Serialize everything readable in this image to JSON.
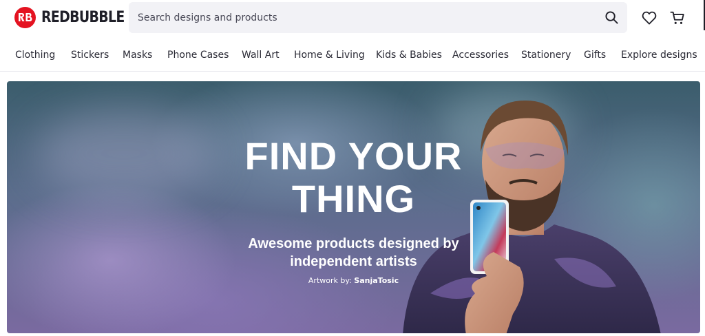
{
  "header": {
    "logo_text": "REDBUBBLE",
    "search_placeholder": "Search designs and products",
    "icons": [
      "search-icon",
      "heart-icon",
      "cart-icon"
    ]
  },
  "nav": {
    "items": [
      "Clothing",
      "Stickers",
      "Masks",
      "Phone Cases",
      "Wall Art",
      "Home & Living",
      "Kids & Babies",
      "Accessories",
      "Stationery",
      "Gifts",
      "Explore designs"
    ]
  },
  "hero": {
    "title_line1": "FIND YOUR",
    "title_line2": "THING",
    "subtitle_line1": "Awesome products designed by",
    "subtitle_line2": "independent artists",
    "credit_prefix": "Artwork by:",
    "credit_artist": "SanjaTosic"
  },
  "colors": {
    "brand_red": "#e41321",
    "text_dark": "#1f1f28",
    "search_bg": "#f2f2f6"
  }
}
